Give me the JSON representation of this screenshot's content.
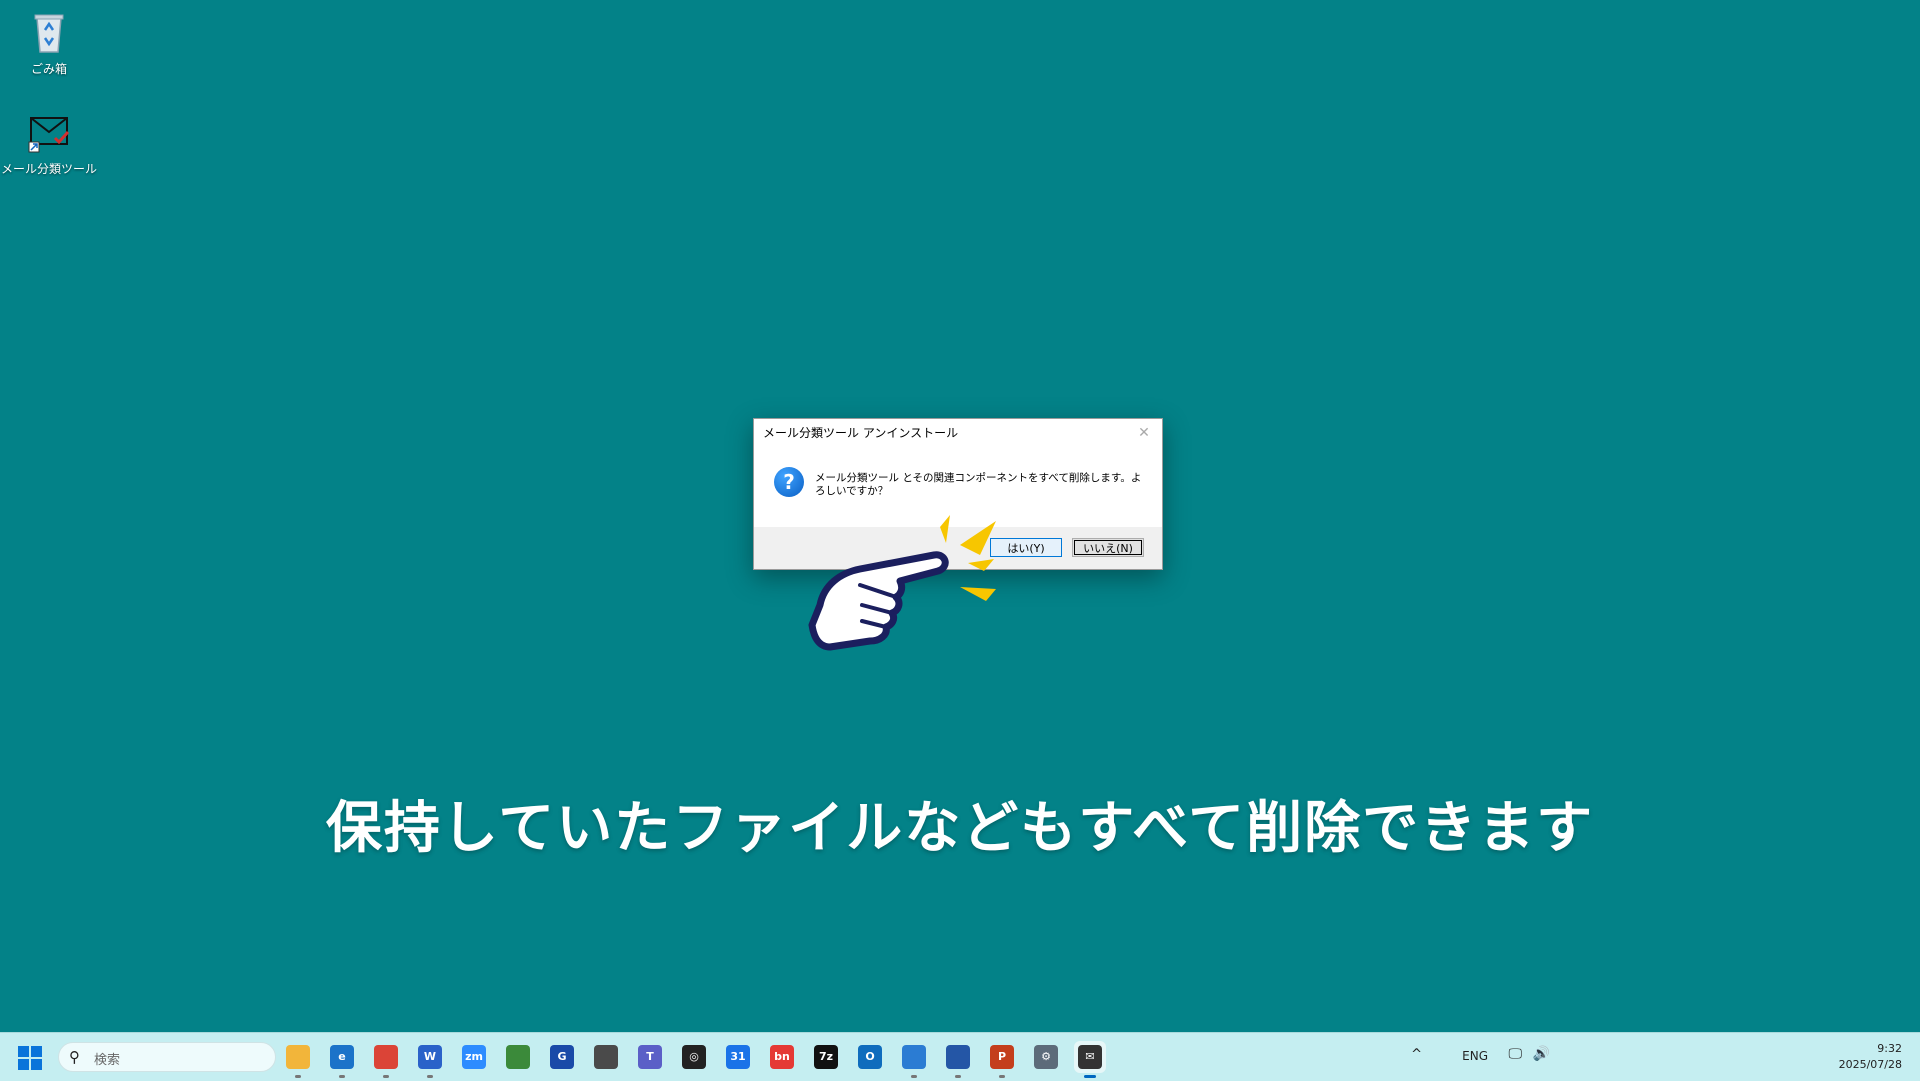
{
  "desktop": {
    "icons": [
      {
        "label": "ごみ箱",
        "icon": "recycle-bin-icon"
      },
      {
        "label": "メール分類ツール",
        "icon": "mail-check-icon"
      }
    ]
  },
  "dialog": {
    "title": "メール分類ツール アンインストール",
    "close_glyph": "✕",
    "icon": "question-icon",
    "icon_glyph": "?",
    "message": "メール分類ツール とその関連コンポーネントをすべて削除します。よろしいですか？",
    "yes_label": "はい(Y)",
    "no_label": "いいえ(N)"
  },
  "caption": "保持していたファイルなどもすべて削除できます",
  "taskbar": {
    "search_placeholder": "検索",
    "apps": [
      {
        "name": "file-explorer",
        "glyph": "",
        "color": "#f2b53a"
      },
      {
        "name": "edge",
        "glyph": "e",
        "color": "#1b73c9"
      },
      {
        "name": "chrome",
        "glyph": "",
        "color": "#db4437"
      },
      {
        "name": "wps-writer",
        "glyph": "W",
        "color": "#2a62c9"
      },
      {
        "name": "zoom",
        "glyph": "zm",
        "color": "#2d8cff"
      },
      {
        "name": "app-green",
        "glyph": "",
        "color": "#3b8a3a"
      },
      {
        "name": "grammarly",
        "glyph": "G",
        "color": "#1a4aa8"
      },
      {
        "name": "calculator",
        "glyph": "",
        "color": "#4a4a4a"
      },
      {
        "name": "teams",
        "glyph": "T",
        "color": "#5b5fc7"
      },
      {
        "name": "chatgpt",
        "glyph": "◎",
        "color": "#222222"
      },
      {
        "name": "calendar",
        "glyph": "31",
        "color": "#1a73e8"
      },
      {
        "name": "app-bn",
        "glyph": "bn",
        "color": "#e53935"
      },
      {
        "name": "7zip",
        "glyph": "7z",
        "color": "#111111"
      },
      {
        "name": "outlook",
        "glyph": "O",
        "color": "#0f6cbd"
      },
      {
        "name": "notepad",
        "glyph": "",
        "color": "#2b7cd3"
      },
      {
        "name": "app-remote",
        "glyph": "",
        "color": "#2456a6"
      },
      {
        "name": "powerpoint",
        "glyph": "P",
        "color": "#c43e1c"
      },
      {
        "name": "settings",
        "glyph": "⚙",
        "color": "#5c6b7a"
      },
      {
        "name": "mail-tool",
        "glyph": "✉",
        "color": "#333333"
      }
    ],
    "tray": {
      "chevron": "^",
      "language": "ENG",
      "time": "9:32",
      "date": "2025/07/28"
    }
  }
}
